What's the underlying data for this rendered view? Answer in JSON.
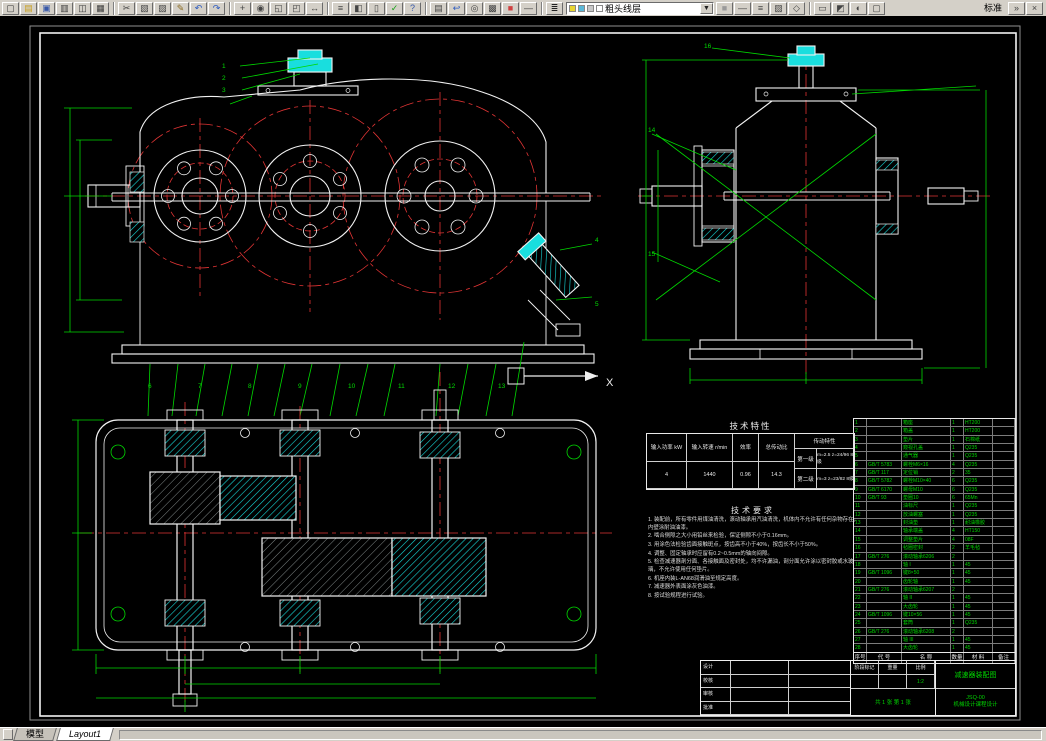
{
  "toolbar": {
    "standard_label": "标准",
    "layer_combo_value": "粗头线层",
    "combo_arrow": "▼",
    "layer_combo_icons": [
      {
        "name": "layer-on-bulb-icon",
        "color": "#e8d531"
      },
      {
        "name": "layer-freeze-icon",
        "color": "#5ab8d8"
      },
      {
        "name": "layer-lock-icon",
        "color": "#c8c8c8"
      },
      {
        "name": "layer-color-swatch",
        "color": "#ffffff"
      }
    ],
    "layers_icon": {
      "name": "layers-icon",
      "glyph": "≣"
    },
    "icons_file": [
      {
        "name": "new-icon",
        "glyph": "▢",
        "color": "#3b3b3b"
      },
      {
        "name": "open-icon",
        "glyph": "▤",
        "color": "#c8a020"
      },
      {
        "name": "save-icon",
        "glyph": "▣",
        "color": "#3858a8"
      },
      {
        "name": "plot-icon",
        "glyph": "▥",
        "color": "#3b3b3b"
      },
      {
        "name": "plot-preview-icon",
        "glyph": "◫",
        "color": "#3b3b3b"
      },
      {
        "name": "publish-icon",
        "glyph": "▦",
        "color": "#3b3b3b"
      }
    ],
    "icons_edit": [
      {
        "name": "cut-icon",
        "glyph": "✂",
        "color": "#444444"
      },
      {
        "name": "copy-icon",
        "glyph": "▧",
        "color": "#444444"
      },
      {
        "name": "paste-icon",
        "glyph": "▨",
        "color": "#444444"
      },
      {
        "name": "match-properties-icon",
        "glyph": "✎",
        "color": "#8a6a20"
      },
      {
        "name": "undo-icon",
        "glyph": "↶",
        "color": "#2858c0"
      },
      {
        "name": "redo-icon",
        "glyph": "↷",
        "color": "#2858c0"
      }
    ],
    "icons_view": [
      {
        "name": "pan-icon",
        "glyph": "+",
        "color": "#444444"
      },
      {
        "name": "zoom-realtime-icon",
        "glyph": "◉",
        "color": "#444444"
      },
      {
        "name": "zoom-window-icon",
        "glyph": "◱",
        "color": "#444444"
      },
      {
        "name": "zoom-previous-icon",
        "glyph": "◰",
        "color": "#444444"
      },
      {
        "name": "distance-icon",
        "glyph": "↔",
        "color": "#444444"
      }
    ],
    "icons_misc": [
      {
        "name": "properties-icon",
        "glyph": "≡",
        "color": "#444444"
      },
      {
        "name": "design-center-icon",
        "glyph": "◧",
        "color": "#444444"
      },
      {
        "name": "tool-palettes-icon",
        "glyph": "▯",
        "color": "#444444"
      },
      {
        "name": "markup-icon",
        "glyph": "✓",
        "color": "#18a018"
      },
      {
        "name": "help-icon",
        "glyph": "?",
        "color": "#3858a8"
      }
    ],
    "icons_layer_tools": [
      {
        "name": "layer-properties-icon",
        "glyph": "▤",
        "color": "#444444"
      },
      {
        "name": "layer-previous-icon",
        "glyph": "↩",
        "color": "#2858c0"
      },
      {
        "name": "make-current-icon",
        "glyph": "◎",
        "color": "#444444"
      },
      {
        "name": "layer-states-icon",
        "glyph": "▩",
        "color": "#444444"
      },
      {
        "name": "color-swatch-icon",
        "glyph": "■",
        "color": "#d04040"
      },
      {
        "name": "linetype-icon",
        "glyph": "―",
        "color": "#444444"
      }
    ],
    "icons_mid": [
      {
        "name": "color-control-icon",
        "glyph": "■",
        "color": "#9a9a9a"
      },
      {
        "name": "linetype-control-icon",
        "glyph": "―",
        "color": "#444444"
      },
      {
        "name": "lineweight-control-icon",
        "glyph": "≡",
        "color": "#444444"
      },
      {
        "name": "plot-style-icon",
        "glyph": "▨",
        "color": "#444444"
      },
      {
        "name": "object-snap-icon",
        "glyph": "◇",
        "color": "#444444"
      }
    ],
    "icons_mid2": [
      {
        "name": "model-paper-toggle-icon",
        "glyph": "▭",
        "color": "#444444"
      },
      {
        "name": "render-icon",
        "glyph": "◩",
        "color": "#444444"
      },
      {
        "name": "orbit-icon",
        "glyph": "◐",
        "color": "#444444"
      },
      {
        "name": "named-views-icon",
        "glyph": "▢",
        "color": "#444444"
      }
    ],
    "icons_far": [
      {
        "name": "workspace-icon",
        "glyph": "»",
        "color": "#444444"
      },
      {
        "name": "close-toolbar-icon",
        "glyph": "×",
        "color": "#444444"
      }
    ]
  },
  "canvas": {
    "axis_label": "X",
    "balloons": [
      "1",
      "2",
      "3",
      "4",
      "5",
      "6",
      "7",
      "8",
      "9",
      "10",
      "11",
      "12",
      "13",
      "14",
      "15",
      "16"
    ],
    "tech_characteristics": {
      "title": "技术特性",
      "headers": [
        "输入功率 kW",
        "输入转速 r/min",
        "效率",
        "总传动比"
      ],
      "values": [
        "4",
        "1440",
        "0.96",
        "14.3"
      ],
      "trans_label": "传动特性",
      "stage_rows": [
        {
          "label": "第一级",
          "data": "m=2.5  z=24/96  8级"
        },
        {
          "label": "第二级",
          "data": "m=3  z=23/82  8级"
        }
      ]
    },
    "tech_requirements": {
      "title": "技术要求",
      "lines": [
        "1. 装配前，所有零件用煤油清洗，滚动轴承用汽油清洗，机体内不允许有任何杂物存在，内壁涂耐油油漆。",
        "2. 啮合侧隙之大小用铅丝来检验，保证侧隙不小于0.16mm。",
        "3. 用涂色法检验齿面接触斑点，按齿高不小于40%，按齿长不小于50%。",
        "4. 调整、固定轴承时应留有0.2~0.5mm的轴向间隙。",
        "5. 检查减速器剖分面、各接触面及密封处，均不许漏油，剖分面允许涂以密封胶或水玻璃，不允许使用任何垫片。",
        "6. 机座内装L-AN68润滑油至规定高度。",
        "7. 减速器外表面涂灰色油漆。",
        "8. 按试验规程进行试验。"
      ]
    },
    "parts_list": {
      "headers": [
        "序号",
        "代 号",
        "名 称",
        "数量",
        "材 料",
        "备注"
      ],
      "rows": [
        {
          "no": "1",
          "code": "",
          "name": "箱座",
          "qty": "1",
          "mat": "HT200"
        },
        {
          "no": "2",
          "code": "",
          "name": "箱盖",
          "qty": "1",
          "mat": "HT200"
        },
        {
          "no": "3",
          "code": "",
          "name": "垫片",
          "qty": "1",
          "mat": "石棉纸"
        },
        {
          "no": "4",
          "code": "",
          "name": "窥视孔盖",
          "qty": "1",
          "mat": "Q235"
        },
        {
          "no": "5",
          "code": "",
          "name": "通气器",
          "qty": "1",
          "mat": "Q235"
        },
        {
          "no": "6",
          "code": "GB/T 5783",
          "name": "螺栓M6×16",
          "qty": "4",
          "mat": "Q235"
        },
        {
          "no": "7",
          "code": "GB/T 117",
          "name": "定位销",
          "qty": "2",
          "mat": "35"
        },
        {
          "no": "8",
          "code": "GB/T 5782",
          "name": "螺栓M10×40",
          "qty": "6",
          "mat": "Q235"
        },
        {
          "no": "9",
          "code": "GB/T 6170",
          "name": "螺母M10",
          "qty": "6",
          "mat": "Q235"
        },
        {
          "no": "10",
          "code": "GB/T 93",
          "name": "垫圈10",
          "qty": "6",
          "mat": "65Mn"
        },
        {
          "no": "11",
          "code": "",
          "name": "油标尺",
          "qty": "1",
          "mat": "Q235"
        },
        {
          "no": "12",
          "code": "",
          "name": "放油螺塞",
          "qty": "1",
          "mat": "Q235"
        },
        {
          "no": "13",
          "code": "",
          "name": "封油垫",
          "qty": "1",
          "mat": "耐油橡胶"
        },
        {
          "no": "14",
          "code": "",
          "name": "轴承端盖",
          "qty": "4",
          "mat": "HT150"
        },
        {
          "no": "15",
          "code": "",
          "name": "调整垫片",
          "qty": "4",
          "mat": "08F"
        },
        {
          "no": "16",
          "code": "",
          "name": "毡圈密封",
          "qty": "2",
          "mat": "羊毛毡"
        },
        {
          "no": "17",
          "code": "GB/T 276",
          "name": "滚动轴承6206",
          "qty": "2",
          "mat": ""
        },
        {
          "no": "18",
          "code": "",
          "name": "轴 I",
          "qty": "1",
          "mat": "45"
        },
        {
          "no": "19",
          "code": "GB/T 1096",
          "name": "键8×50",
          "qty": "1",
          "mat": "45"
        },
        {
          "no": "20",
          "code": "",
          "name": "齿轮轴",
          "qty": "1",
          "mat": "45"
        },
        {
          "no": "21",
          "code": "GB/T 276",
          "name": "滚动轴承6207",
          "qty": "2",
          "mat": ""
        },
        {
          "no": "22",
          "code": "",
          "name": "轴 II",
          "qty": "1",
          "mat": "45"
        },
        {
          "no": "23",
          "code": "",
          "name": "大齿轮",
          "qty": "1",
          "mat": "45"
        },
        {
          "no": "24",
          "code": "GB/T 1096",
          "name": "键10×56",
          "qty": "1",
          "mat": "45"
        },
        {
          "no": "25",
          "code": "",
          "name": "套筒",
          "qty": "1",
          "mat": "Q235"
        },
        {
          "no": "26",
          "code": "GB/T 276",
          "name": "滚动轴承6208",
          "qty": "2",
          "mat": ""
        },
        {
          "no": "27",
          "code": "",
          "name": "轴 III",
          "qty": "1",
          "mat": "45"
        },
        {
          "no": "28",
          "code": "",
          "name": "大齿轮",
          "qty": "1",
          "mat": "45"
        }
      ]
    },
    "title_block": {
      "sign_rows": [
        "设计",
        "校核",
        "审核",
        "批准"
      ],
      "stage_mark_label": "阶段标记",
      "weight_label": "重量",
      "scale_label": "比例",
      "scale_value": "1:2",
      "sheet_text": "共 1 张  第 1 张",
      "drawing_title": "减速器装配图",
      "drawing_code": "JSQ-00",
      "org_text": "机械设计课程设计"
    }
  },
  "status_bar": {
    "tabs": [
      {
        "label": "模型"
      },
      {
        "label": "Layout1"
      }
    ]
  }
}
